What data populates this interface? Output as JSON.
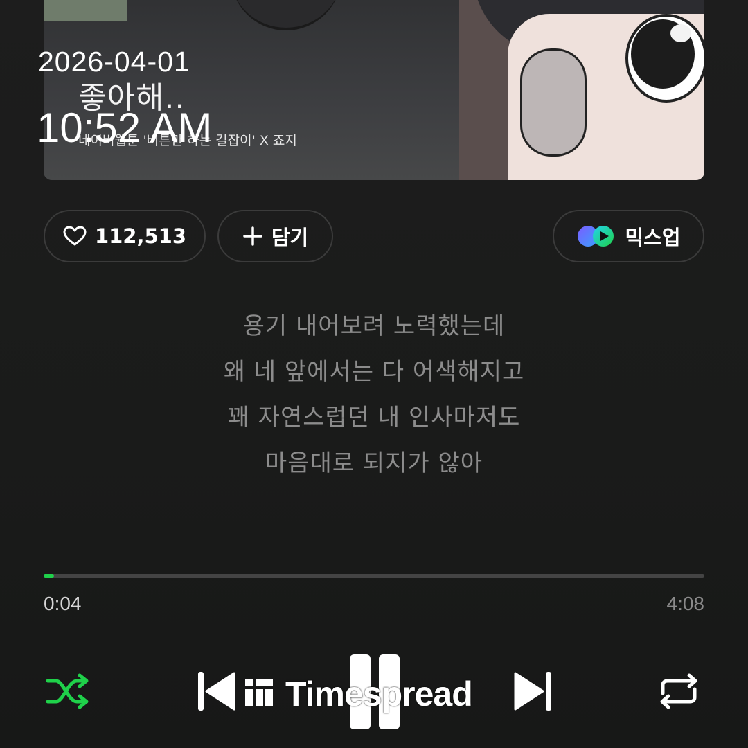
{
  "album_art": {
    "title": "좋아해..",
    "credit": "네이버웹툰 '버튼만 하는 길잡이' X 죠지"
  },
  "overlay": {
    "date": "2026-04-01",
    "time": "10:52 AM"
  },
  "actions": {
    "like_count": "112,513",
    "add_label": "담기",
    "mixup_label": "믹스업"
  },
  "lyrics": [
    "용기 내어보려 노력했는데",
    "왜 네 앞에서는 다 어색해지고",
    "꽤 자연스럽던 내 인사마저도",
    "마음대로 되지가 않아"
  ],
  "progress": {
    "current": "0:04",
    "total": "4:08",
    "fraction": 0.016
  },
  "controls": {
    "shuffle_icon": "shuffle-icon",
    "prev_icon": "skip-previous-icon",
    "pause_icon": "pause-icon",
    "next_icon": "skip-next-icon",
    "repeat_icon": "repeat-icon"
  },
  "watermark": {
    "text": "Timespread"
  },
  "colors": {
    "accent": "#1fd14a",
    "background": "#1c1c1c",
    "lyric": "#8c8c8c"
  }
}
